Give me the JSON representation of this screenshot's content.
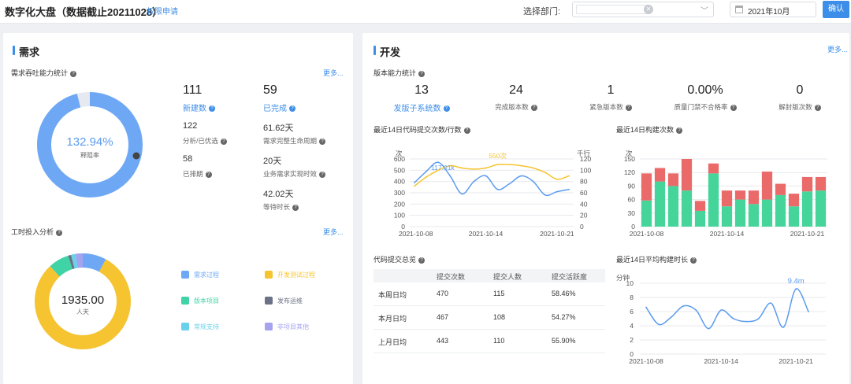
{
  "header": {
    "title": "数字化大盘（数据截止20211028）",
    "permission_link": "权限申请",
    "dept_label": "选择部门:",
    "month_value": "2021年10月",
    "confirm_label": "确认"
  },
  "demand": {
    "title": "需求",
    "throughput_title": "需求吞吐能力统计",
    "more_label": "更多...",
    "ring_value": "132.94%",
    "ring_label": "释阻率",
    "ring_fraction": 0.96,
    "new_count": "111",
    "new_label": "新建数",
    "done_count": "59",
    "done_label": "已完成",
    "stats": [
      {
        "value": "122",
        "label": "分析/已优选"
      },
      {
        "value": "61.62天",
        "label": "需求完整生命周期"
      },
      {
        "value": "58",
        "label": "已排期"
      },
      {
        "value": "20天",
        "label": "业务需求实现时效"
      },
      {
        "value": "42.02天",
        "label": "等待时长"
      }
    ],
    "effort_title": "工时投入分析",
    "effort_more": "更多...",
    "effort_total": "1935.00",
    "effort_unit": "人天",
    "legend": [
      {
        "label": "需求过程",
        "color": "#6ea8f5"
      },
      {
        "label": "开发测试过程",
        "color": "#f6c431"
      },
      {
        "label": "版本项目",
        "color": "#3fd3a5"
      },
      {
        "label": "发布运维",
        "color": "#6b7287"
      },
      {
        "label": "常规支持",
        "color": "#69d1ea"
      },
      {
        "label": "非项目其他",
        "color": "#a5a3ef"
      }
    ],
    "effort_shares": [
      0.08,
      0.8,
      0.07,
      0.01,
      0.015,
      0.025
    ]
  },
  "dev": {
    "title": "开发",
    "more_label": "更多...",
    "version_title": "版本能力统计",
    "version_stats": [
      {
        "value": "13",
        "label": "发版子系统数",
        "link": true
      },
      {
        "value": "24",
        "label": "完成版本数",
        "link": false
      },
      {
        "value": "1",
        "label": "紧急版本数",
        "link": false
      },
      {
        "value": "0.00%",
        "label": "质量门禁不合格率",
        "link": false
      },
      {
        "value": "0",
        "label": "解封版次数",
        "link": false
      }
    ],
    "commit_chart_title": "最近14日代码提交次数/行数",
    "build_chart_title": "最近14日构建次数",
    "overview_title": "代码提交总览",
    "avg_build_title": "最近14日平均构建时长",
    "table": {
      "headers": [
        "",
        "提交次数",
        "提交人数",
        "提交活跃度"
      ],
      "rows": [
        [
          "本周日均",
          "470",
          "115",
          "58.46%"
        ],
        [
          "本月日均",
          "467",
          "108",
          "54.27%"
        ],
        [
          "上月日均",
          "443",
          "110",
          "55.90%"
        ]
      ]
    }
  },
  "chart_data": [
    {
      "type": "line",
      "title": "最近14日代码提交次数/行数",
      "ylabel_left": "次",
      "ylabel_right": "千行",
      "x_ticks": [
        "2021-10-08",
        "2021-10-14",
        "2021-10-21"
      ],
      "y_left_ticks": [
        0,
        100,
        200,
        300,
        400,
        500,
        600
      ],
      "y_right_ticks": [
        0,
        20,
        40,
        60,
        80,
        100,
        120
      ],
      "ylim_left": [
        0,
        600
      ],
      "ylim_right": [
        0,
        120
      ],
      "annotations": [
        "117.01k",
        "550次"
      ],
      "series": [
        {
          "axis": "left",
          "color": "#5b9bef",
          "values": [
            390,
            490,
            570,
            450,
            290,
            400,
            450,
            330,
            380,
            450,
            400,
            280,
            310,
            330
          ]
        },
        {
          "axis": "right",
          "color": "#f6c431",
          "values": [
            72,
            88,
            100,
            108,
            104,
            102,
            104,
            110,
            110,
            108,
            104,
            96,
            84,
            90
          ]
        }
      ]
    },
    {
      "type": "bar",
      "title": "最近14日构建次数",
      "ylabel": "次",
      "x_ticks": [
        "2021-10-08",
        "2021-10-14",
        "2021-10-21"
      ],
      "y_ticks": [
        0,
        30,
        60,
        90,
        120,
        150
      ],
      "ylim": [
        0,
        150
      ],
      "series": [
        {
          "color": "#45d49a",
          "values": [
            58,
            100,
            90,
            80,
            35,
            118,
            45,
            60,
            50,
            60,
            70,
            45,
            78,
            80
          ]
        },
        {
          "color": "#ea6a6a",
          "values": [
            60,
            30,
            28,
            70,
            22,
            22,
            35,
            20,
            30,
            62,
            25,
            28,
            32,
            30
          ]
        }
      ]
    },
    {
      "type": "line",
      "title": "最近14日平均构建时长",
      "ylabel": "分钟",
      "x_ticks": [
        "2021-10-08",
        "2021-10-14",
        "2021-10-21"
      ],
      "y_ticks": [
        0,
        2,
        4,
        6,
        8,
        10
      ],
      "ylim": [
        0,
        10
      ],
      "annotations": [
        "9.4m"
      ],
      "series": [
        {
          "color": "#5b9bef",
          "values": [
            6.6,
            4.2,
            5.2,
            6.8,
            6.2,
            3.6,
            6.2,
            5.0,
            4.6,
            5.0,
            7.2,
            3.8,
            9.2,
            6.0
          ]
        }
      ]
    }
  ]
}
